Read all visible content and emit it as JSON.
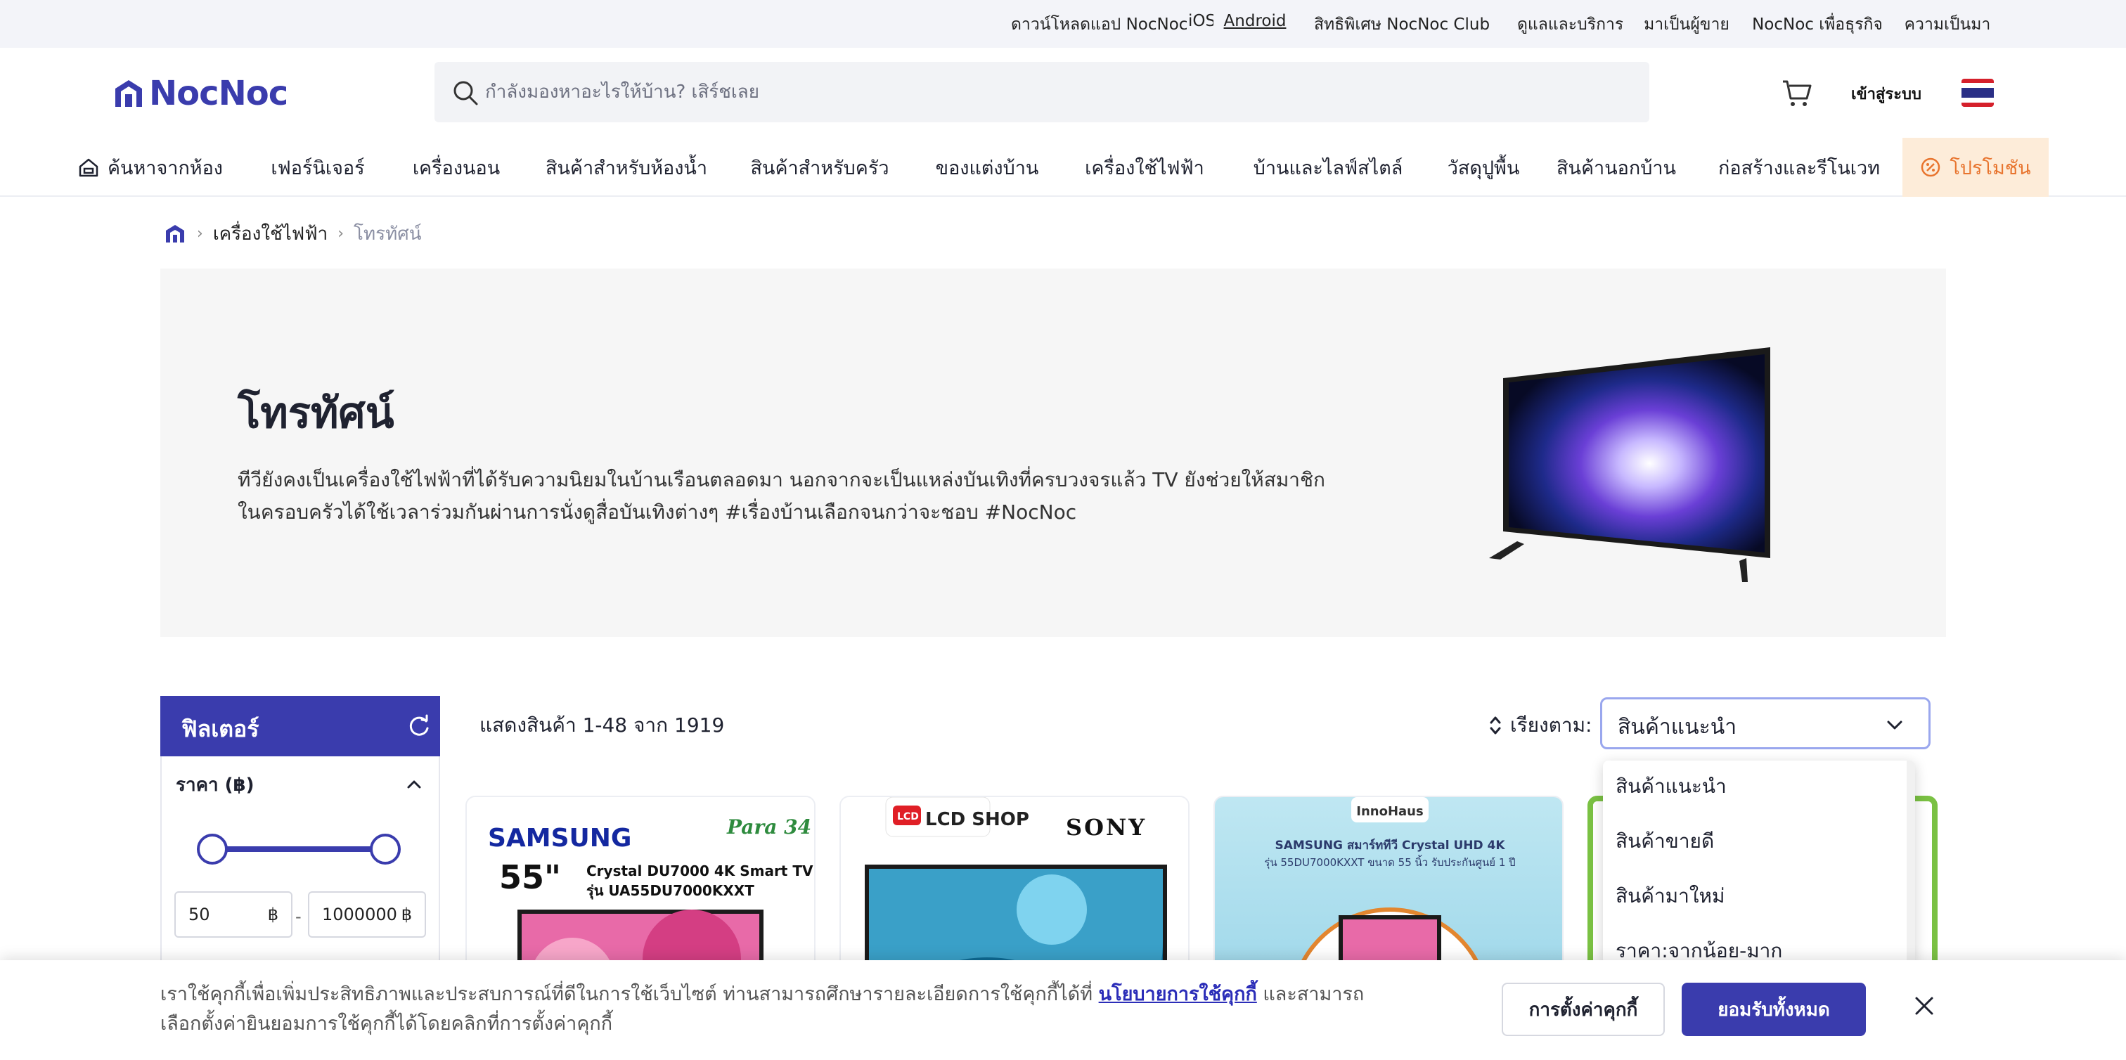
{
  "topbar": {
    "download": "ดาวน์โหลดแอป NocNoc",
    "links": [
      {
        "label": "iOS"
      },
      {
        "label": "Android"
      },
      {
        "label": "สิทธิพิเศษ NocNoc Club"
      },
      {
        "label": "ดูแลและบริการ"
      },
      {
        "label": "มาเป็นผู้ขาย"
      },
      {
        "label": "NocNoc เพื่อธุรกิจ"
      },
      {
        "label": "ความเป็นมา"
      }
    ]
  },
  "header": {
    "logo_text": "NocNoc",
    "search_placeholder": "กำลังมองหาอะไรให้บ้าน? เสิร์ชเลย",
    "login_label": "เข้าสู่ระบบ"
  },
  "nav": {
    "items": [
      {
        "label": "ค้นหาจากห้อง"
      },
      {
        "label": "เฟอร์นิเจอร์"
      },
      {
        "label": "เครื่องนอน"
      },
      {
        "label": "สินค้าสำหรับห้องน้ำ"
      },
      {
        "label": "สินค้าสำหรับครัว"
      },
      {
        "label": "ของแต่งบ้าน"
      },
      {
        "label": "เครื่องใช้ไฟฟ้า"
      },
      {
        "label": "บ้านและไลฟ์สไตล์"
      },
      {
        "label": "วัสดุปูพื้น"
      },
      {
        "label": "สินค้านอกบ้าน"
      },
      {
        "label": "ก่อสร้างและรีโนเวท"
      },
      {
        "label": "โปรโมชัน"
      }
    ]
  },
  "breadcrumb": {
    "items": [
      {
        "label": "เครื่องใช้ไฟฟ้า"
      },
      {
        "label": "โทรทัศน์"
      }
    ]
  },
  "hero": {
    "title": "โทรทัศน์",
    "description": "ทีวียังคงเป็นเครื่องใช้ไฟฟ้าที่ได้รับความนิยมในบ้านเรือนตลอดมา นอกจากจะเป็นแหล่งบันเทิงที่ครบวงจรแล้ว TV ยังช่วยให้สมาชิกในครอบครัวได้ใช้เวลาร่วมกันผ่านการนั่งดูสื่อบันเทิงต่างๆ #เรื่องบ้านเลือกจนกว่าจะชอบ #NocNoc"
  },
  "filter": {
    "title": "ฟิลเตอร์",
    "price_section": "ราคา (฿)",
    "min_knob": "50",
    "max_knob": "1000000",
    "min_value": "50",
    "max_value": "1000000",
    "currency": "฿",
    "dash": "-"
  },
  "listing": {
    "count_text": "แสดงสินค้า 1-48 จาก 1919",
    "sort_label": "เรียงตาม:",
    "sort_selected": "สินค้าแนะนำ",
    "sort_options": [
      {
        "label": "สินค้าแนะนำ"
      },
      {
        "label": "สินค้าขายดี"
      },
      {
        "label": "สินค้ามาใหม่"
      },
      {
        "label": "ราคา:จากน้อย-มาก"
      }
    ]
  },
  "cards": [
    {
      "brand": "SAMSUNG",
      "tag": "Para 34",
      "size": "55\"",
      "line1": "Crystal DU7000 4K Smart TV",
      "line2": "รุ่น UA55DU7000KXXT"
    },
    {
      "shop": "LCD SHOP",
      "brand": "SONY"
    },
    {
      "store": "InnoHaus",
      "line1": "SAMSUNG สมาร์ททีวี Crystal UHD 4K",
      "line2": "รุ่น 55DU7000KXXT ขนาด 55 นิ้ว รับประกันศูนย์ 1 ปี"
    },
    {}
  ],
  "cookie": {
    "text_before": "เราใช้คุกกี้เพื่อเพิ่มประสิทธิภาพและประสบการณ์ที่ดีในการใช้เว็บไซต์ ท่านสามารถศึกษารายละเอียดการใช้คุกกี้ได้ที่ ",
    "link": "นโยบายการใช้คุกกี้",
    "text_after": " และสามารถเลือกตั้งค่ายินยอมการใช้คุกกี้ได้โดยคลิกที่การตั้งค่าคุกกี้",
    "settings_label": "การตั้งค่าคุกกี้",
    "accept_label": "ยอมรับทั้งหมด"
  },
  "colors": {
    "brand": "#3a3cad",
    "promo_bg": "#fdecd9",
    "promo_text": "#e8742e",
    "hero_bg": "#f6f6f6"
  },
  "icons": [
    "search-icon",
    "cart-icon",
    "thai-flag-icon",
    "home-icon",
    "refresh-icon",
    "chevron-up-icon",
    "chevron-down-icon",
    "sort-icon",
    "promo-icon",
    "close-icon"
  ]
}
